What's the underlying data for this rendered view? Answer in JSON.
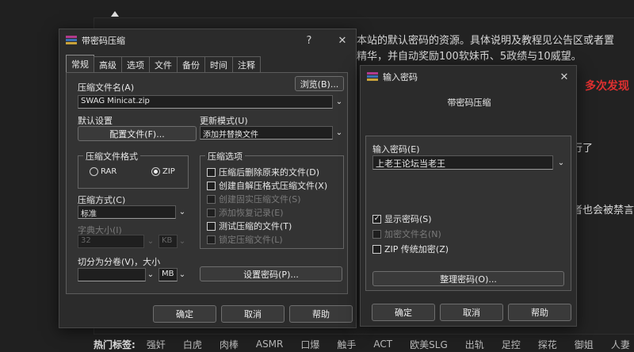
{
  "background": {
    "line1": "本站的默认密码的资源。具体说明及教程见公告区或者置",
    "line2": "精华，并自动奖励100软妹币、5政绩与10威望。",
    "red_text": "多次发现",
    "right_frag1": "行了",
    "right_frag2": "者也会被禁言",
    "tags_title": "热门标签:",
    "tags": [
      "强奸",
      "白虎",
      "肉棒",
      "ASMR",
      "口爆",
      "触手",
      "ACT",
      "欧美SLG",
      "出轨",
      "足控",
      "探花",
      "御姐",
      "人妻"
    ]
  },
  "main_dialog": {
    "title": "带密码压缩",
    "help_btn": "?",
    "close_btn": "✕",
    "tabs": [
      "常规",
      "高级",
      "选项",
      "文件",
      "备份",
      "时间",
      "注释"
    ],
    "archive_name_label": "压缩文件名(A)",
    "browse_label": "浏览(B)...",
    "archive_name_value": "SWAG Minicat.zip",
    "default_settings_label": "默认设置",
    "profiles_btn": "配置文件(F)...",
    "update_mode_label": "更新模式(U)",
    "update_mode_value": "添加并替换文件",
    "format_group": "压缩文件格式",
    "format_rar": "RAR",
    "format_zip": "ZIP",
    "options_group": "压缩选项",
    "options": [
      {
        "label": "压缩后删除原来的文件(D)",
        "checked": false,
        "enabled": true
      },
      {
        "label": "创建自解压格式压缩文件(X)",
        "checked": false,
        "enabled": true
      },
      {
        "label": "创建固实压缩文件(S)",
        "checked": false,
        "enabled": false
      },
      {
        "label": "添加恢复记录(E)",
        "checked": false,
        "enabled": false
      },
      {
        "label": "测试压缩的文件(T)",
        "checked": false,
        "enabled": true
      },
      {
        "label": "锁定压缩文件(L)",
        "checked": false,
        "enabled": false
      }
    ],
    "method_label": "压缩方式(C)",
    "method_value": "标准",
    "dict_label": "字典大小(I)",
    "dict_value": "32",
    "dict_unit": "KB",
    "split_label": "切分为分卷(V)，大小",
    "split_unit": "MB",
    "set_password_btn": "设置密码(P)...",
    "ok": "确定",
    "cancel": "取消",
    "help": "帮助"
  },
  "password_dialog": {
    "title": "输入密码",
    "close_btn": "✕",
    "subtitle": "带密码压缩",
    "enter_label": "输入密码(E)",
    "password_value": "上老王论坛当老王",
    "show_password": "显示密码(S)",
    "encrypt_names": "加密文件名(N)",
    "zip_legacy": "ZIP 传统加密(Z)",
    "organize_btn": "整理密码(O)...",
    "ok": "确定",
    "cancel": "取消",
    "help": "帮助"
  }
}
